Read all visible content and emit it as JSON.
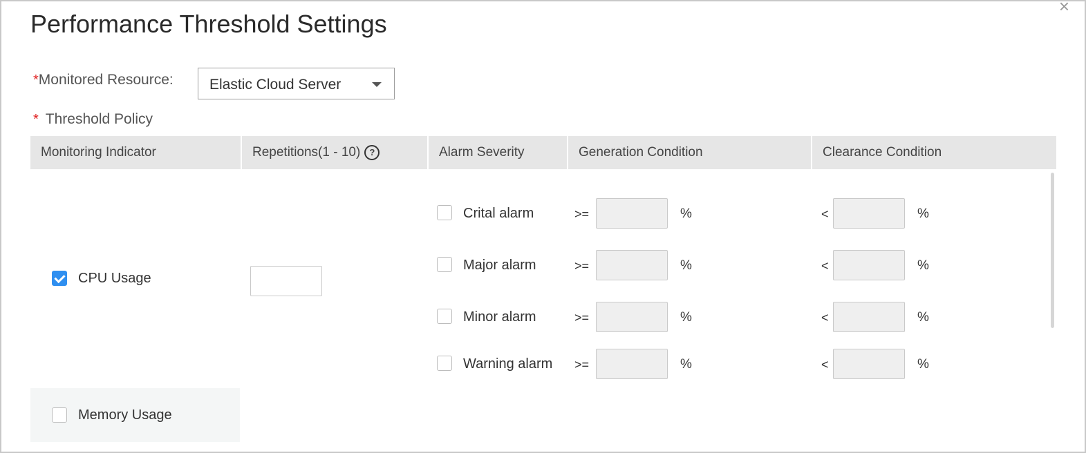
{
  "dialog": {
    "title": "Performance Threshold Settings",
    "close_glyph": "×"
  },
  "resource": {
    "required_mark": "*",
    "label": "Monitored Resource:",
    "selected": "Elastic Cloud Server"
  },
  "policy": {
    "required_mark": "*",
    "label": "Threshold Policy"
  },
  "table": {
    "headers": [
      "Monitoring Indicator",
      "Repetitions(1 - 10)",
      "Alarm Severity",
      "Generation Condition",
      "Clearance Condition"
    ],
    "help_glyph": "?"
  },
  "indicators": [
    {
      "label": "CPU Usage",
      "checked": true
    },
    {
      "label": "Memory Usage",
      "checked": false
    }
  ],
  "alarms": [
    {
      "label": "Crital alarm",
      "gen_op": ">=",
      "clear_op": "<",
      "unit": "%"
    },
    {
      "label": "Major alarm",
      "gen_op": ">=",
      "clear_op": "<",
      "unit": "%"
    },
    {
      "label": "Minor alarm",
      "gen_op": ">=",
      "clear_op": "<",
      "unit": "%"
    },
    {
      "label": "Warning alarm",
      "gen_op": ">=",
      "clear_op": "<",
      "unit": "%"
    }
  ]
}
